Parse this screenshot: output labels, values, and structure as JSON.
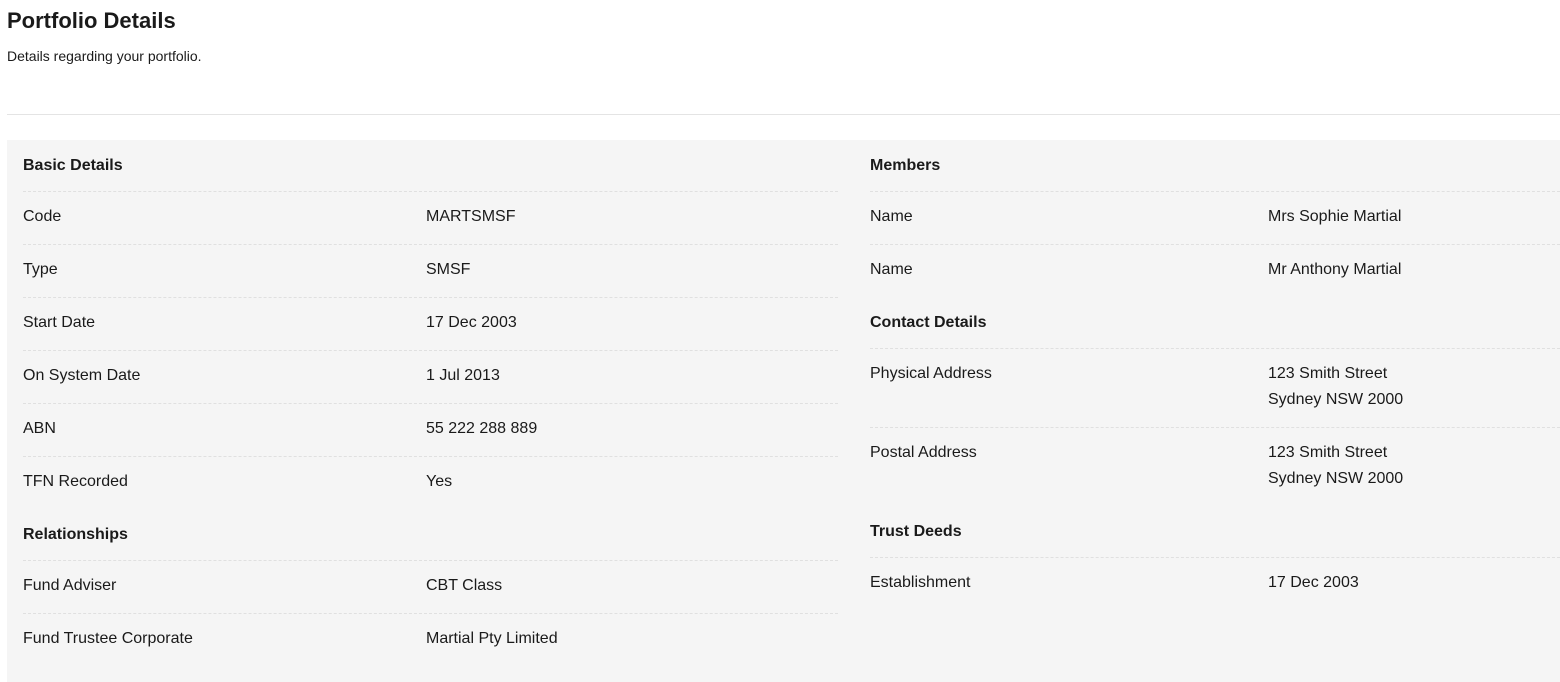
{
  "header": {
    "title": "Portfolio Details",
    "subtitle": "Details regarding your portfolio."
  },
  "basic_details": {
    "heading": "Basic Details",
    "rows": [
      {
        "label": "Code",
        "value": "MARTSMSF"
      },
      {
        "label": "Type",
        "value": "SMSF"
      },
      {
        "label": "Start Date",
        "value": "17 Dec 2003"
      },
      {
        "label": "On System Date",
        "value": "1 Jul 2013"
      },
      {
        "label": "ABN",
        "value": "55 222 288 889"
      },
      {
        "label": "TFN Recorded",
        "value": "Yes"
      }
    ]
  },
  "relationships": {
    "heading": "Relationships",
    "rows": [
      {
        "label": "Fund Adviser",
        "value": "CBT Class"
      },
      {
        "label": "Fund Trustee Corporate",
        "value": "Martial Pty Limited"
      }
    ]
  },
  "members": {
    "heading": "Members",
    "rows": [
      {
        "label": "Name",
        "value": "Mrs Sophie Martial"
      },
      {
        "label": "Name",
        "value": "Mr Anthony Martial"
      }
    ]
  },
  "contact_details": {
    "heading": "Contact Details",
    "rows": [
      {
        "label": "Physical Address",
        "line1": "123 Smith Street",
        "line2": "Sydney NSW 2000"
      },
      {
        "label": "Postal Address",
        "line1": "123 Smith Street",
        "line2": "Sydney NSW 2000"
      }
    ]
  },
  "trust_deeds": {
    "heading": "Trust Deeds",
    "rows": [
      {
        "label": "Establishment",
        "value": "17 Dec 2003"
      }
    ]
  }
}
